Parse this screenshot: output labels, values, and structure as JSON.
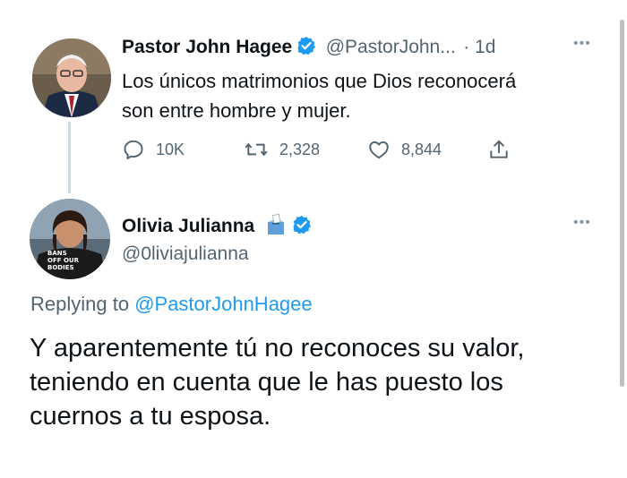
{
  "original_tweet": {
    "author_name": "Pastor John Hagee",
    "handle": "@PastorJohn...",
    "time": "· 1d",
    "text_line1": "Los únicos matrimonios que Dios reconocerá",
    "text_line2": "son entre hombre y mujer.",
    "replies": "10K",
    "retweets": "2,328",
    "likes": "8,844"
  },
  "reply_tweet": {
    "author_name": "Olivia Julianna",
    "handle": "@0liviajulianna",
    "replying_prefix": "Replying to ",
    "replying_handle": "@PastorJohnHagee",
    "text_line1": "Y aparentemente tú no reconoces su valor,",
    "text_line2": "teniendo en cuenta que le has puesto los",
    "text_line3": "cuernos a tu esposa.",
    "avatar_shirt_text": "BANS OFF OUR BODIES"
  },
  "colors": {
    "verified": "#1d9bf0",
    "secondary_text": "#536471",
    "link": "#1d9bf0"
  },
  "icons": [
    "verified-badge-icon",
    "more-options-icon",
    "reply-icon",
    "retweet-icon",
    "like-icon",
    "share-icon",
    "ballot-box-icon"
  ]
}
